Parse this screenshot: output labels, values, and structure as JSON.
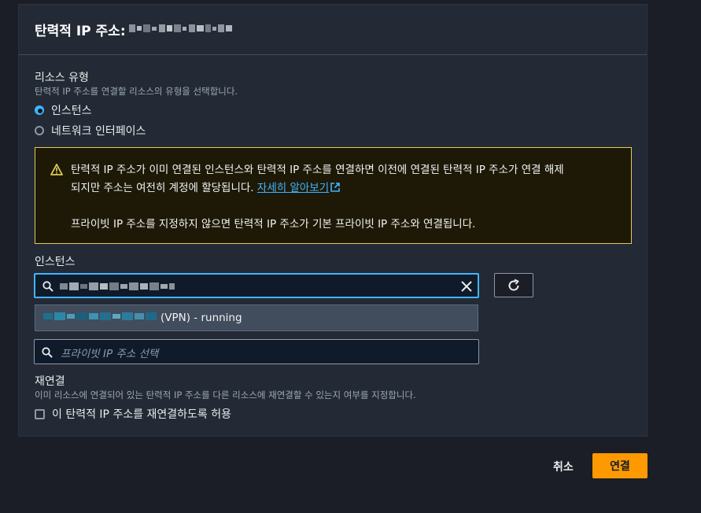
{
  "dialog": {
    "title": "탄력적 IP 주소:"
  },
  "resource_type": {
    "label": "리소스 유형",
    "description": "탄력적 IP 주소를 연결할 리소스의 유형을 선택합니다.",
    "options": [
      {
        "label": "인스턴스",
        "selected": true
      },
      {
        "label": "네트워크 인터페이스",
        "selected": false
      }
    ]
  },
  "alert": {
    "line1": "탄력적 IP 주소가 이미 연결된 인스턴스와 탄력적 IP 주소를 연결하면 이전에 연결된 탄력적 IP 주소가 연결 해제",
    "line2_prefix": "되지만 주소는 여전히 계정에 할당됩니다.",
    "link_text": "자세히 알아보기",
    "line3": "프라이빗 IP 주소를 지정하지 않으면 탄력적 IP 주소가 기본 프라이빗 IP 주소와 연결됩니다.",
    "icon": "warning-icon"
  },
  "instance": {
    "label": "인스턴스",
    "search_value": "",
    "dropdown_option_suffix": "(VPN) - running"
  },
  "private_ip": {
    "placeholder": "프라이빗 IP 주소 선택"
  },
  "reassociate": {
    "label": "재연결",
    "description": "이미 리소스에 연결되어 있는 탄력적 IP 주소를 다른 리소스에 재연결할 수 있는지 여부를 지정합니다.",
    "checkbox_label": "이 탄력적 IP 주소를 재연결하도록 허용",
    "checked": false
  },
  "footer": {
    "cancel_label": "취소",
    "submit_label": "연결"
  },
  "colors": {
    "accent": "#42b4ff",
    "primary_button": "#ff9900",
    "alert_border": "#e0ca57"
  }
}
